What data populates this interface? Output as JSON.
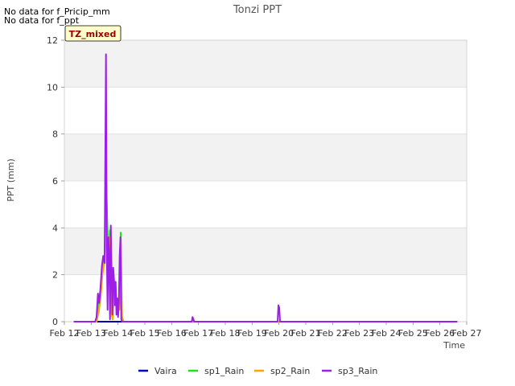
{
  "messages": [
    "No data for f_Pricip_mm",
    "No data for f_ppt"
  ],
  "site_tag": "TZ_mixed",
  "chart_data": {
    "type": "line",
    "title": "Tonzi PPT",
    "xlabel": "Time",
    "ylabel": "PPT (mm)",
    "x_ticks": [
      "Feb 12",
      "Feb 13",
      "Feb 14",
      "Feb 15",
      "Feb 16",
      "Feb 17",
      "Feb 18",
      "Feb 19",
      "Feb 20",
      "Feb 21",
      "Feb 22",
      "Feb 23",
      "Feb 24",
      "Feb 25",
      "Feb 26",
      "Feb 27"
    ],
    "xlim": [
      12,
      27
    ],
    "ylim": [
      0,
      12
    ],
    "y_ticks": [
      0,
      2,
      4,
      6,
      8,
      10,
      12
    ],
    "grid": true,
    "legend_position": "bottom",
    "series": [
      {
        "name": "Vaira",
        "color": "#0000bb",
        "x": [
          12.35,
          26.65
        ],
        "y": [
          0,
          0
        ]
      },
      {
        "name": "sp1_Rain",
        "color": "#22dd22",
        "x": [
          12.35,
          13.2,
          13.28,
          13.35,
          13.42,
          13.5,
          13.55,
          13.6,
          13.65,
          13.7,
          13.75,
          13.8,
          13.85,
          13.9,
          13.95,
          14.0,
          14.05,
          14.1,
          14.15,
          14.2,
          14.25,
          26.65
        ],
        "y": [
          0,
          0,
          1.0,
          1.3,
          2.4,
          2.8,
          6.5,
          4.3,
          2.5,
          3.9,
          0.5,
          0.1,
          1.4,
          1.7,
          0.5,
          0.8,
          0.6,
          3.8,
          0.2,
          0,
          0,
          0
        ]
      },
      {
        "name": "sp2_Rain",
        "color": "#ffa500",
        "x": [
          12.35,
          13.2,
          13.28,
          13.35,
          13.42,
          13.5,
          13.55,
          13.6,
          13.65,
          13.7,
          13.75,
          13.8,
          13.85,
          13.9,
          13.95,
          14.0,
          14.05,
          14.1,
          14.15,
          14.2,
          14.25,
          26.65
        ],
        "y": [
          0,
          0,
          0.4,
          1.0,
          2.0,
          2.6,
          6.0,
          3.0,
          2.3,
          3.6,
          0.4,
          0.1,
          1.3,
          1.5,
          0.4,
          0.7,
          0.5,
          3.4,
          0.1,
          0,
          0,
          0
        ]
      },
      {
        "name": "sp3_Rain",
        "color": "#9b1fe8",
        "x": [
          12.35,
          13.15,
          13.2,
          13.25,
          13.3,
          13.35,
          13.4,
          13.45,
          13.5,
          13.55,
          13.58,
          13.61,
          13.64,
          13.67,
          13.7,
          13.73,
          13.76,
          13.79,
          13.82,
          13.85,
          13.88,
          13.91,
          13.94,
          13.97,
          14.0,
          14.03,
          14.06,
          14.09,
          14.12,
          14.15,
          14.2,
          16.75,
          16.78,
          16.81,
          16.84,
          19.95,
          19.98,
          20.01,
          20.04,
          26.65
        ],
        "y": [
          0,
          0,
          0.2,
          1.2,
          0.8,
          1.5,
          2.4,
          2.8,
          2.5,
          11.4,
          3.0,
          0.5,
          3.6,
          2.7,
          0.1,
          4.1,
          2.0,
          0.3,
          2.3,
          1.8,
          0.7,
          1.7,
          0.3,
          1.0,
          0.2,
          0.8,
          2.8,
          3.6,
          0.1,
          0,
          0,
          0,
          0.2,
          0.1,
          0,
          0,
          0.7,
          0.6,
          0,
          0
        ]
      }
    ]
  }
}
